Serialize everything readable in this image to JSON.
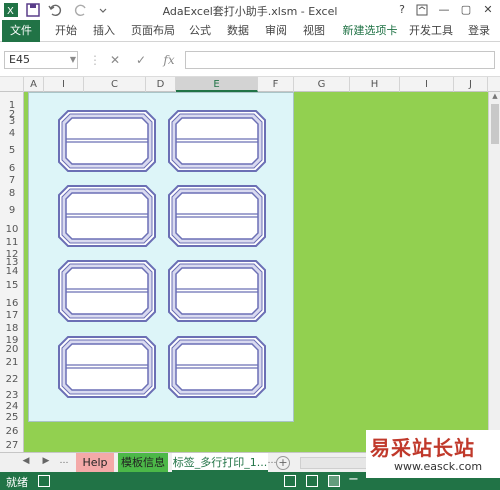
{
  "window": {
    "title": "AdaExcel套打小助手.xlsm - Excel",
    "help": "?",
    "minimize": "—",
    "maximize": "▢",
    "close": "✕"
  },
  "ribbon": {
    "tabs": [
      "文件",
      "开始",
      "插入",
      "页面布局",
      "公式",
      "数据",
      "审阅",
      "视图",
      "新建选项卡",
      "开发工具",
      "登录"
    ]
  },
  "formula_bar": {
    "name_box": "E45",
    "cancel": "✕",
    "enter": "✓",
    "fx": "fx",
    "formula": ""
  },
  "columns": [
    "A",
    "I",
    "C",
    "D",
    "E",
    "F",
    "G",
    "H",
    "I",
    "J"
  ],
  "selected_column": "E",
  "rows": [
    "1",
    "2",
    "3",
    "4",
    "5",
    "6",
    "7",
    "8",
    "9",
    "10",
    "11",
    "12",
    "13",
    "14",
    "15",
    "16",
    "17",
    "18",
    "19",
    "20",
    "21",
    "22",
    "23",
    "24",
    "25",
    "26",
    "27"
  ],
  "sheets": [
    {
      "name": "Help",
      "color": "#f4a9a8"
    },
    {
      "name": "模板信息",
      "color": "#4cb848"
    },
    {
      "name": "标签_多行打印_1...",
      "color": "#ffffff"
    }
  ],
  "status": {
    "ready": "就绪"
  },
  "watermark": {
    "text": "易采站长站",
    "url": "www.easck.com"
  },
  "colors": {
    "excel_green": "#217346",
    "sheet_background": "#92d050",
    "print_area": "#ddf5f8",
    "label_border": "#6b6fb5"
  }
}
